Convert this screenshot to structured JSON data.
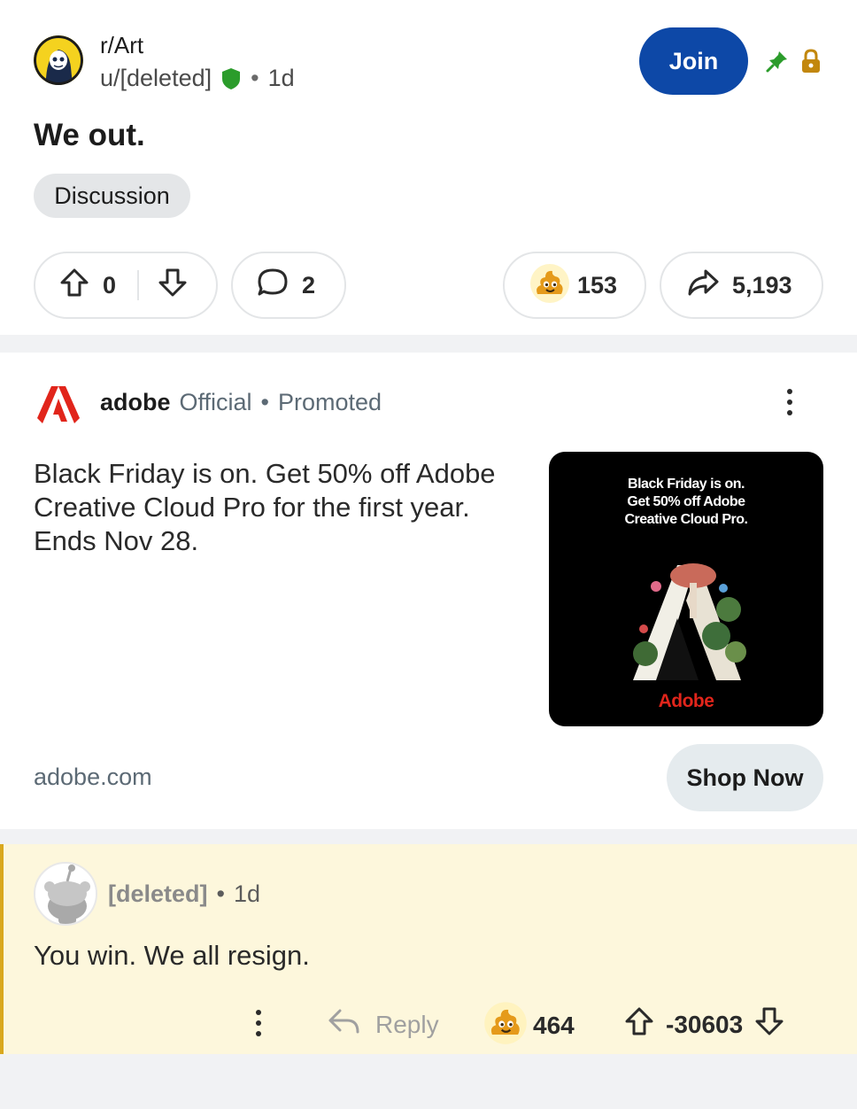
{
  "post": {
    "subreddit": "r/Art",
    "author": "u/[deleted]",
    "time": "1d",
    "join_label": "Join",
    "title": "We out.",
    "flair": "Discussion",
    "score": "0",
    "comments": "2",
    "awards": "153",
    "shares": "5,193"
  },
  "ad": {
    "brand": "adobe",
    "official": "Official",
    "promoted": "Promoted",
    "text": "Black Friday is on. Get 50% off Adobe Creative Cloud Pro for the first year. Ends Nov 28.",
    "image_text_line1": "Black Friday is on.",
    "image_text_line2": "Get 50% off Adobe",
    "image_text_line3": "Creative Cloud Pro.",
    "image_brand": "Adobe",
    "domain": "adobe.com",
    "cta": "Shop Now"
  },
  "comment": {
    "author": "[deleted]",
    "time": "1d",
    "body": "You win. We all resign.",
    "reply_label": "Reply",
    "awards": "464",
    "score": "-30603"
  },
  "colors": {
    "join_blue": "#0d48a7",
    "mod_green": "#2b9c2b",
    "adobe_red": "#e1251b",
    "comment_highlight": "#fdf7dc",
    "highlight_border": "#d9a81e"
  },
  "icons": [
    "shield-icon",
    "pin-icon",
    "lock-icon",
    "upvote-icon",
    "downvote-icon",
    "comment-icon",
    "award-icon",
    "share-icon",
    "kebab-icon",
    "reply-icon"
  ]
}
